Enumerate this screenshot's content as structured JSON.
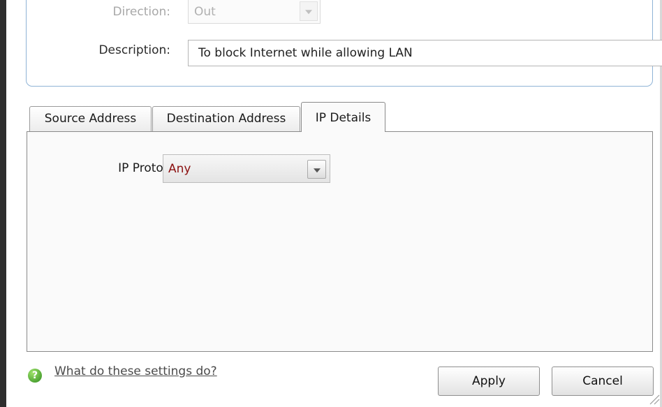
{
  "form": {
    "direction_label": "Direction:",
    "direction_value": "Out",
    "description_label": "Description:",
    "description_value": "To block Internet while allowing LAN"
  },
  "tabs": [
    {
      "label": "Source Address",
      "active": false
    },
    {
      "label": "Destination Address",
      "active": false
    },
    {
      "label": "IP Details",
      "active": true
    }
  ],
  "ip_details": {
    "protocol_label": "IP Protocol:",
    "protocol_value": "Any"
  },
  "footer": {
    "help_text": "What do these settings do?",
    "help_icon": "help-question-icon",
    "apply_label": "Apply",
    "cancel_label": "Cancel"
  },
  "colors": {
    "group_border": "#8fb3d6",
    "protocol_value_text": "#8b1010",
    "help_icon_green": "#2e8b1e"
  }
}
